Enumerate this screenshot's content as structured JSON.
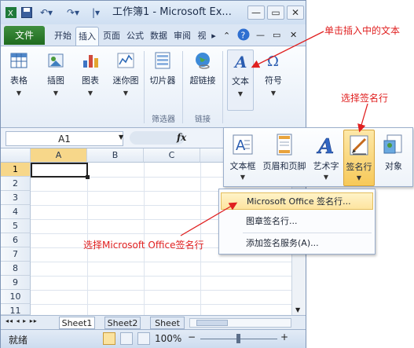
{
  "window": {
    "title": "工作簿1 - Microsoft Ex...",
    "minimize": "—",
    "restore": "▭",
    "close": "✕"
  },
  "tabs": {
    "file": "文件",
    "items": [
      "开始",
      "插入",
      "页面",
      "公式",
      "数据",
      "审阅",
      "视"
    ],
    "active": "插入",
    "more": "▸"
  },
  "ribbon": {
    "buttons": [
      {
        "label": "表格",
        "icon": "table-icon"
      },
      {
        "label": "插图",
        "icon": "picture-icon"
      },
      {
        "label": "图表",
        "icon": "chart-icon"
      },
      {
        "label": "迷你图",
        "icon": "sparkline-icon"
      },
      {
        "label": "切片器",
        "icon": "slicer-icon"
      },
      {
        "label": "超链接",
        "icon": "hyperlink-globe-icon"
      },
      {
        "label": "文本",
        "icon": "text-a-icon"
      },
      {
        "label": "符号",
        "icon": "omega-icon"
      }
    ],
    "groups": {
      "filter": "筛选器",
      "links": "链接"
    }
  },
  "formula_bar": {
    "name_box": "A1",
    "fx": "fx"
  },
  "grid": {
    "columns": [
      "A",
      "B",
      "C"
    ],
    "rows": [
      "1",
      "2",
      "3",
      "4",
      "5",
      "6",
      "7",
      "8",
      "9",
      "10",
      "11"
    ],
    "selected_cell": "A1"
  },
  "sheets": {
    "tabs": [
      "Sheet1",
      "Sheet2",
      "Sheet"
    ],
    "active": "Sheet1",
    "nav": "◂◂ ◂ ▸ ▸▸"
  },
  "status": {
    "ready": "就绪",
    "zoom": "100%",
    "minus": "−",
    "plus": "+"
  },
  "text_panel": {
    "items": [
      {
        "label": "文本框",
        "icon": "textbox-icon"
      },
      {
        "label": "页眉和页脚",
        "icon": "header-footer-icon"
      },
      {
        "label": "艺术字",
        "icon": "wordart-icon"
      },
      {
        "label": "签名行",
        "icon": "signature-pen-icon"
      },
      {
        "label": "对象",
        "icon": "object-icon"
      }
    ]
  },
  "signature_menu": {
    "items": [
      "Microsoft Office 签名行...",
      "图章签名行...",
      "添加签名服务(A)..."
    ]
  },
  "annotations": {
    "click_text": "单击插入中的文本",
    "choose_sigline": "选择签名行",
    "choose_ms_office": "选择Microsoft Office签名行"
  },
  "colors": {
    "annotation": "#e02020",
    "file_tab": "#2a7a2a",
    "highlight": "#fde4a0"
  }
}
